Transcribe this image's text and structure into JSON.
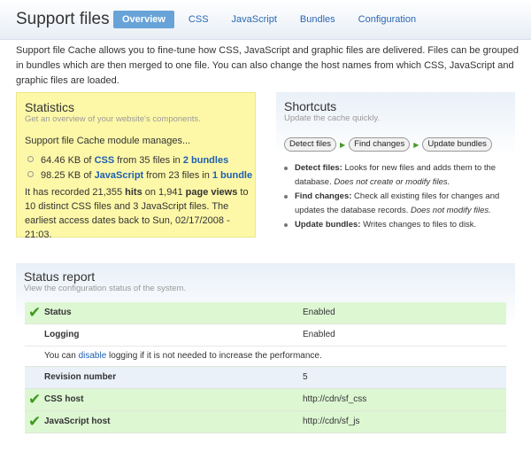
{
  "header": {
    "title": "Support files",
    "tabs": [
      {
        "label": "Overview",
        "active": true
      },
      {
        "label": "CSS"
      },
      {
        "label": "JavaScript"
      },
      {
        "label": "Bundles"
      },
      {
        "label": "Configuration"
      }
    ]
  },
  "intro": "Support file Cache allows you to fine-tune how CSS, JavaScript and graphic files are delivered. Files can be grouped in bundles which are then merged to one file. You can also change the host names from which CSS, JavaScript and graphic files are loaded.",
  "statistics": {
    "title": "Statistics",
    "subtitle": "Get an overview of your website's components.",
    "lead": "Support file Cache module manages...",
    "css": {
      "size": "64.46 KB of",
      "type": "CSS",
      "from": "from 35 files in",
      "bundles": "2 bundles"
    },
    "js": {
      "size": "98.25 KB of",
      "type": "JavaScript",
      "from": "from 23 files in",
      "bundles": "1 bundle"
    },
    "recorded": {
      "pre": "It has recorded 21,355",
      "hits": "hits",
      "mid": "on 1,941",
      "views": "page views",
      "post": "to 10 distinct CSS files and 3 JavaScript files. The earliest access dates back to Sun, 02/17/2008 - 21:03."
    }
  },
  "shortcuts": {
    "title": "Shortcuts",
    "subtitle": "Update the cache quickly.",
    "buttons": [
      "Detect files",
      "Find changes",
      "Update bundles"
    ],
    "items": [
      {
        "name": "Detect files:",
        "text": "Looks for new files and adds them to the database.",
        "note": "Does not create or modify files."
      },
      {
        "name": "Find changes:",
        "text": "Check all existing files for changes and updates the database records.",
        "note": "Does not modify files."
      },
      {
        "name": "Update bundles:",
        "text": "Writes changes to files to disk.",
        "note": ""
      }
    ]
  },
  "status_report": {
    "title": "Status report",
    "subtitle": "View the configuration status of the system.",
    "rows": [
      {
        "label": "Status",
        "value": "Enabled",
        "ok": true
      },
      {
        "label": "Logging",
        "value": "Enabled",
        "ok": false
      },
      {
        "info_pre": "You can",
        "info_link": "disable",
        "info_post": "logging if it is not needed to increase the performance."
      },
      {
        "label": "Revision number",
        "value": "5",
        "ok": false
      },
      {
        "label": "CSS host",
        "value": "http://cdn/sf_css",
        "ok": true
      },
      {
        "label": "JavaScript host",
        "value": "http://cdn/sf_js",
        "ok": true
      }
    ]
  },
  "icons": {
    "check": "checkmark-icon",
    "arrow": "arrow-right-icon"
  },
  "colors": {
    "accent": "#68a3d8",
    "link": "#1f5fb0",
    "ok_row": "#ddf7d3",
    "stats_bg": "#fdf8a8",
    "check": "#3f9a1e"
  }
}
